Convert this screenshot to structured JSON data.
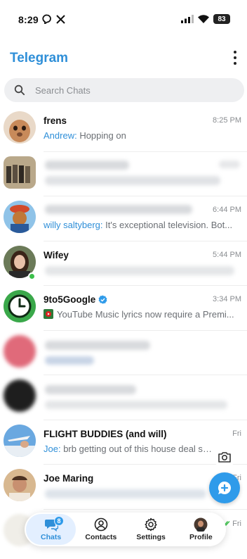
{
  "status_bar": {
    "time": "8:29",
    "battery": "83",
    "left_icons": [
      "chat-bubble-icon",
      "x-logo-icon"
    ],
    "right_icons": [
      "signal-icon",
      "wifi-icon",
      "battery-icon"
    ]
  },
  "header": {
    "title": "Telegram",
    "brand_color": "#2f8fd8"
  },
  "search": {
    "placeholder": "Search Chats"
  },
  "chats": [
    {
      "name": "frens",
      "time": "8:25 PM",
      "sender": "Andrew:",
      "preview": " Hopping on"
    },
    {
      "name": "",
      "time": "",
      "sender": "",
      "preview": ""
    },
    {
      "name": "",
      "time": "6:44 PM",
      "sender": "willy saltyberg:",
      "preview": " It's exceptional television. Bot..."
    },
    {
      "name": "Wifey",
      "time": "5:44 PM",
      "sender": "",
      "preview": ""
    },
    {
      "name": "9to5Google",
      "time": "3:34 PM",
      "sender": "",
      "preview": "YouTube Music lyrics now require a Premi..."
    },
    {
      "name": "",
      "time": "",
      "sender": "",
      "preview": ""
    },
    {
      "name": "",
      "time": "",
      "sender": "",
      "preview": ""
    },
    {
      "name": "FLIGHT BUDDIES (and will)",
      "time": "Fri",
      "sender": "Joe:",
      "preview": " brb getting out of this house deal sc..."
    },
    {
      "name": "Joe Maring",
      "time": "Fri",
      "sender": "",
      "preview": ""
    },
    {
      "name": "",
      "time": "Fri",
      "sender": "",
      "preview": ""
    }
  ],
  "nav": {
    "chats": "Chats",
    "chats_badge": "8",
    "contacts": "Contacts",
    "settings": "Settings",
    "profile": "Profile"
  }
}
